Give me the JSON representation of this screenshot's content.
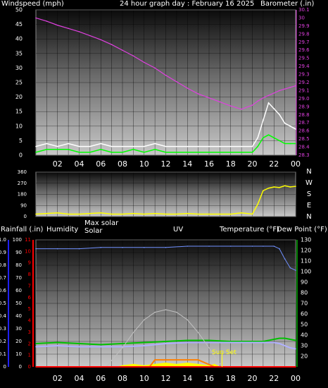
{
  "header": {
    "left_label": "Windspeed (mph)",
    "title": "24 hour graph day : February 16 2025",
    "right_label": "Barometer (.in)"
  },
  "colors": {
    "wind_avg": "#00ff00",
    "wind_gust": "#ffffff",
    "barometer": "#e040e0",
    "wind_dir": "#ffff00",
    "uv": "#ff8000",
    "temperature": "#7090ff",
    "dew_point": "#00c000",
    "humidity": "#b0b0ff",
    "solar": "#ffff00",
    "max_solar": "#c0c0c0",
    "rain": "#ff0000",
    "axis_rain": "#2020ff",
    "axis_uv": "#ff0000",
    "axis_temp": "#00ff00"
  },
  "x_ticks": [
    "02",
    "04",
    "06",
    "08",
    "10",
    "12",
    "14",
    "16",
    "18",
    "20",
    "22",
    "00"
  ],
  "chart_data": [
    {
      "type": "line",
      "x_hours": [
        0,
        1,
        2,
        3,
        4,
        5,
        6,
        7,
        8,
        9,
        10,
        11,
        12,
        13,
        14,
        15,
        16,
        17,
        18,
        19,
        20,
        20.5,
        21,
        21.5,
        22,
        22.5,
        23,
        23.5,
        24
      ],
      "ylim": [
        0,
        50
      ],
      "y_ticks": [
        "0",
        "5",
        "10",
        "15",
        "20",
        "25",
        "30",
        "35",
        "40",
        "45",
        "50"
      ],
      "y2lim": [
        28.3,
        30.1
      ],
      "y2_ticks": [
        "28.3",
        "28.4",
        "28.5",
        "28.6",
        "28.7",
        "28.8",
        "28.9",
        "29.0",
        "29.1",
        "29.2",
        "29.3",
        "29.4",
        "29.5",
        "29.6",
        "29.7",
        "29.8",
        "29.9",
        "30",
        "30.1"
      ],
      "xlabel": "",
      "series": [
        {
          "color_key": "wind_gust",
          "values": [
            3,
            4,
            3,
            4,
            3,
            3,
            4,
            3,
            3,
            3,
            3,
            4,
            3,
            3,
            3,
            3,
            3,
            3,
            3,
            3,
            3,
            6,
            12,
            18,
            16,
            14,
            11,
            10,
            9
          ]
        },
        {
          "color_key": "wind_avg",
          "values": [
            1,
            2,
            2,
            2,
            1,
            1,
            2,
            1,
            1,
            2,
            1,
            2,
            1,
            1,
            1,
            1,
            1,
            1,
            1,
            1,
            1,
            3,
            6,
            7,
            6,
            5,
            4,
            4,
            4
          ]
        },
        {
          "color_key": "barometer",
          "axis": "right",
          "values": [
            30.0,
            29.96,
            29.91,
            29.87,
            29.83,
            29.78,
            29.73,
            29.67,
            29.6,
            29.53,
            29.45,
            29.38,
            29.29,
            29.21,
            29.13,
            29.06,
            29.01,
            28.96,
            28.91,
            28.87,
            28.92,
            28.97,
            29.01,
            29.04,
            29.07,
            29.1,
            29.12,
            29.14,
            29.16
          ]
        }
      ]
    },
    {
      "type": "line",
      "ylim": [
        0,
        360
      ],
      "y_ticks": [
        "0",
        "90",
        "180",
        "270",
        "360"
      ],
      "compass": [
        "N",
        "W",
        "S",
        "E",
        "N"
      ],
      "series": [
        {
          "color_key": "wind_dir",
          "x_hours": [
            0,
            1,
            2,
            3,
            4,
            5,
            6,
            7,
            8,
            9,
            10,
            11,
            12,
            13,
            14,
            15,
            16,
            17,
            18,
            19,
            20,
            20.5,
            21,
            21.5,
            22,
            22.5,
            23,
            23.5,
            24
          ],
          "values": [
            20,
            25,
            30,
            20,
            20,
            25,
            30,
            20,
            20,
            25,
            20,
            25,
            20,
            20,
            25,
            20,
            20,
            20,
            20,
            30,
            20,
            100,
            210,
            230,
            240,
            235,
            250,
            240,
            245
          ]
        }
      ]
    },
    {
      "type": "line",
      "legend": [
        "Rainfall (.in)",
        "Humidity",
        "Max solar",
        "Solar",
        "UV",
        "Temperature (°F)",
        "Dew Point (°F)"
      ],
      "annotation": "Sun Set",
      "rain_ylim": [
        0,
        1.0
      ],
      "rain_ticks": [
        "0",
        "0.1",
        "0.2",
        "0.3",
        "0.4",
        "0.5",
        "0.6",
        "0.7",
        "0.8",
        "0.9",
        "1.0"
      ],
      "hum_ylim": [
        0,
        100
      ],
      "hum_ticks": [
        "0",
        "10",
        "20",
        "30",
        "40",
        "50",
        "60",
        "70",
        "80",
        "90",
        "100"
      ],
      "uv_ylim": [
        0,
        11
      ],
      "uv_ticks": [
        "0",
        "1",
        "2",
        "3",
        "4",
        "5",
        "6",
        "7",
        "8",
        "9",
        "10",
        "11"
      ],
      "temp_ylim": [
        10,
        130
      ],
      "temp_ticks": [
        "20",
        "30",
        "40",
        "50",
        "60",
        "70",
        "80",
        "90",
        "100",
        "110",
        "120",
        "130"
      ],
      "series": [
        {
          "name": "Humidity",
          "color_key": "temperature",
          "x_hours": [
            0,
            2,
            4,
            6,
            8,
            10,
            12,
            14,
            16,
            18,
            20,
            21,
            22,
            22.5,
            23,
            23.5,
            24
          ],
          "values": [
            93,
            93,
            93,
            94,
            94,
            94,
            94,
            95,
            95,
            95,
            95,
            95,
            95,
            93,
            85,
            78,
            76
          ]
        },
        {
          "name": "Temperature (°F)",
          "color_key": "dew_point",
          "x_hours": [
            0,
            2,
            4,
            6,
            8,
            10,
            12,
            14,
            16,
            18,
            20,
            21,
            22,
            22.5,
            23,
            23.5,
            24
          ],
          "values": [
            32,
            33,
            32,
            31,
            32,
            33,
            34,
            35,
            35,
            34,
            34,
            34,
            36,
            37,
            37,
            36,
            35
          ]
        },
        {
          "name": "Dew Point (°F)",
          "color_key": "humidity",
          "x_hours": [
            0,
            2,
            4,
            6,
            8,
            10,
            12,
            14,
            16,
            18,
            20,
            21,
            22,
            22.5,
            23,
            23.5,
            24
          ],
          "values": [
            29,
            30,
            29,
            29,
            29,
            30,
            32,
            33,
            33,
            33,
            33,
            33,
            33,
            32,
            30,
            28,
            27
          ]
        },
        {
          "name": "Max solar",
          "color_key": "max_solar",
          "x_hours": [
            6.5,
            7,
            8,
            9,
            10,
            11,
            12,
            13,
            14,
            15,
            16,
            16.5,
            17.2
          ],
          "values": [
            0,
            5,
            15,
            27,
            37,
            43,
            45,
            43,
            37,
            27,
            15,
            8,
            0
          ]
        },
        {
          "name": "Solar",
          "color_key": "solar",
          "x_hours": [
            7.5,
            8,
            9,
            10,
            11,
            12,
            13,
            14,
            15,
            16,
            16.5,
            17
          ],
          "values": [
            0,
            1,
            2,
            1,
            2,
            3,
            2,
            3,
            2,
            1,
            2,
            0
          ]
        },
        {
          "name": "UV",
          "color_key": "uv",
          "x_hours": [
            10.5,
            11,
            15,
            16.5
          ],
          "values": [
            0,
            0.6,
            0.6,
            0
          ]
        },
        {
          "name": "Rainfall (.in)",
          "color_key": "rain",
          "x_hours": [
            0,
            24
          ],
          "values": [
            0.0,
            0.0
          ]
        }
      ]
    }
  ]
}
